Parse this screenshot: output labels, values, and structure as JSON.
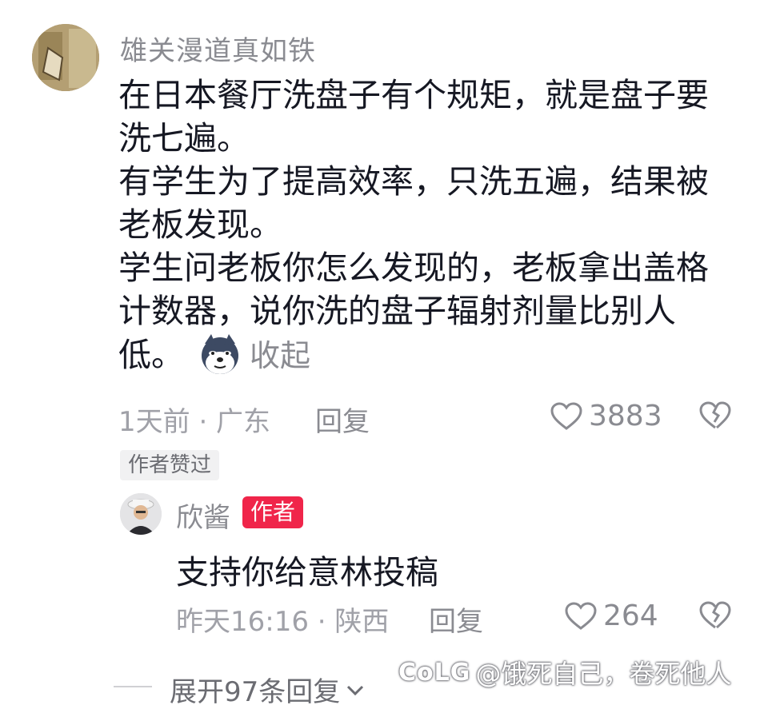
{
  "comment": {
    "username": "雄关漫道真如铁",
    "lines": [
      "在日本餐厅洗盘子有个规矩，就是盘子要",
      "洗七遍。",
      "有学生为了提高效率，只洗五遍，结果被",
      "老板发现。",
      "学生问老板你怎么发现的，老板拿出盖格",
      "计数器，说你洗的盘子辐射剂量比别人",
      "低。"
    ],
    "collapse_label": "收起",
    "time_location": "1天前 · 广东",
    "reply_label": "回复",
    "like_count": "3883",
    "author_liked_label": "作者赞过"
  },
  "reply": {
    "username": "欣酱",
    "badge": "作者",
    "text": "支持你给意林投稿",
    "time_location": "昨天16:16 · 陕西",
    "reply_label": "回复",
    "like_count": "264"
  },
  "expand_replies_label": "展开97条回复",
  "watermark": {
    "logo": "CoLG",
    "text": "@饿死自己，卷死他人"
  },
  "colors": {
    "accent_red": "#f0254a",
    "muted_gray": "#8a8b91",
    "text_dark": "#161823"
  }
}
